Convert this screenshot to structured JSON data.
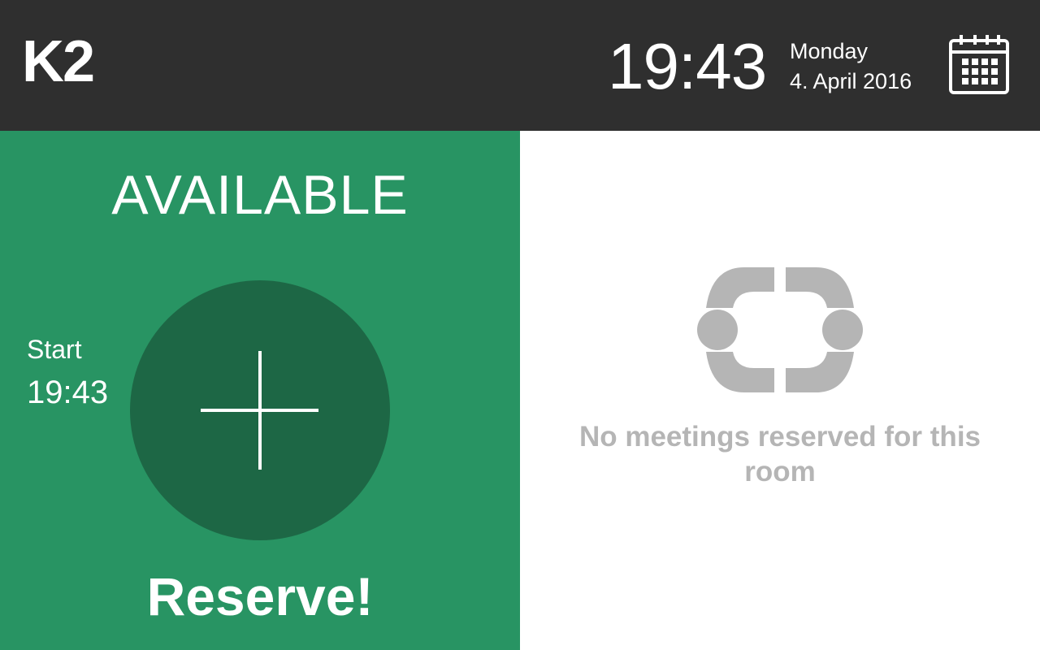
{
  "header": {
    "room_name": "K2",
    "time": "19:43",
    "weekday": "Monday",
    "date": "4. April 2016",
    "calendar_icon": "calendar-icon"
  },
  "booking": {
    "status": "AVAILABLE",
    "start_label": "Start",
    "start_time": "19:43",
    "add_icon": "plus-icon",
    "reserve_label": "Reserve!"
  },
  "schedule": {
    "empty_icon": "meeting-table-icon",
    "empty_message": "No meetings reserved for this room"
  },
  "colors": {
    "header_bg": "#2f2f2f",
    "available_green": "#289463",
    "button_dark_green": "#1d6745",
    "muted_gray": "#b5b5b5"
  }
}
